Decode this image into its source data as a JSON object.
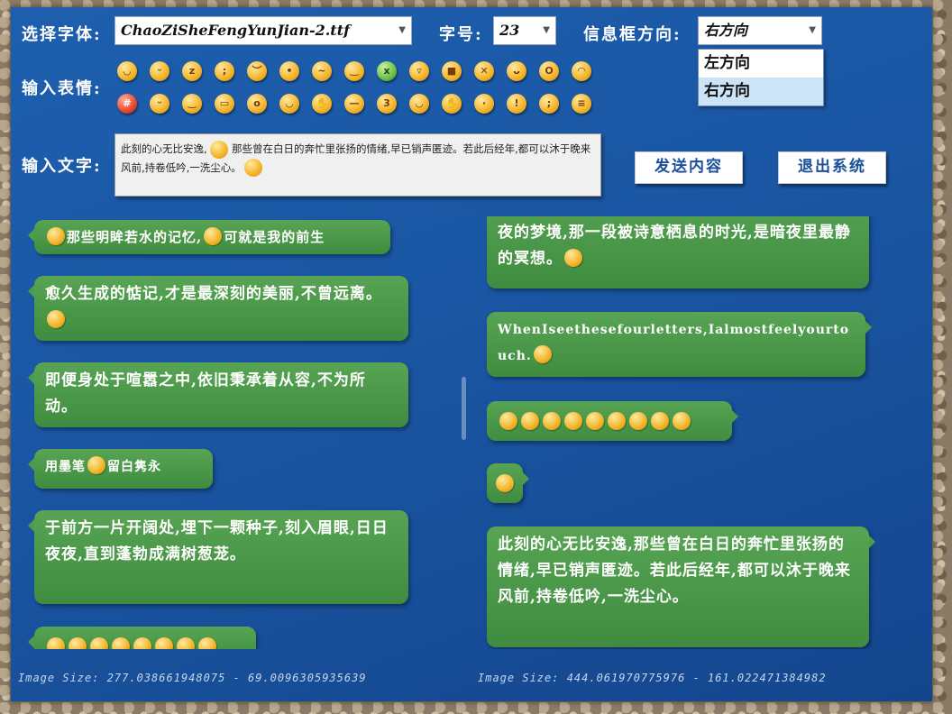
{
  "labels": {
    "font": "选择字体:",
    "size": "字号:",
    "direction": "信息框方向:",
    "emoji": "输入表情:",
    "text": "输入文字:"
  },
  "font_select": {
    "value": "ChaoZiSheFengYunJian-2.ttf"
  },
  "size_select": {
    "value": "23"
  },
  "direction_select": {
    "value": "右方向",
    "options": [
      "左方向",
      "右方向"
    ]
  },
  "input": {
    "text_a": "此刻的心无比安逸,",
    "text_b": "那些曾在白日的奔忙里张扬的情绪,早已销声匿迹。若此后经年,都可以沐于晚来风前,持卷低吟,一洗尘心。"
  },
  "buttons": {
    "send": "发送内容",
    "exit": "退出系统"
  },
  "left_messages": {
    "m1": "那些明眸若水的记忆,",
    "m1b": "可就是我的前生",
    "m2": "愈久生成的惦记,才是最深刻的美丽,不曾远离。",
    "m3": "即便身处于喧嚣之中,依旧秉承着从容,不为所动。",
    "m4a": "用墨笔",
    "m4b": "留白隽永",
    "m5": "于前方一片开阔处,埋下一颗种子,刻入眉眼,日日夜夜,直到蓬勃成满树葱茏。"
  },
  "right_messages": {
    "m1": "夜的梦境,那一段被诗意栖息的时光,是暗夜里最静的冥想。",
    "m2": "WhenIseethesefourletters,Ialmostfeelyourtouch.",
    "m5": "此刻的心无比安逸,那些曾在白日的奔忙里张扬的情绪,早已销声匿迹。若此后经年,都可以沐于晚来风前,持卷低吟,一洗尘心。"
  },
  "status": {
    "left": "Image Size: 277.038661948075 - 69.0096305935639",
    "right": "Image Size: 444.061970775976 - 161.022471384982"
  }
}
